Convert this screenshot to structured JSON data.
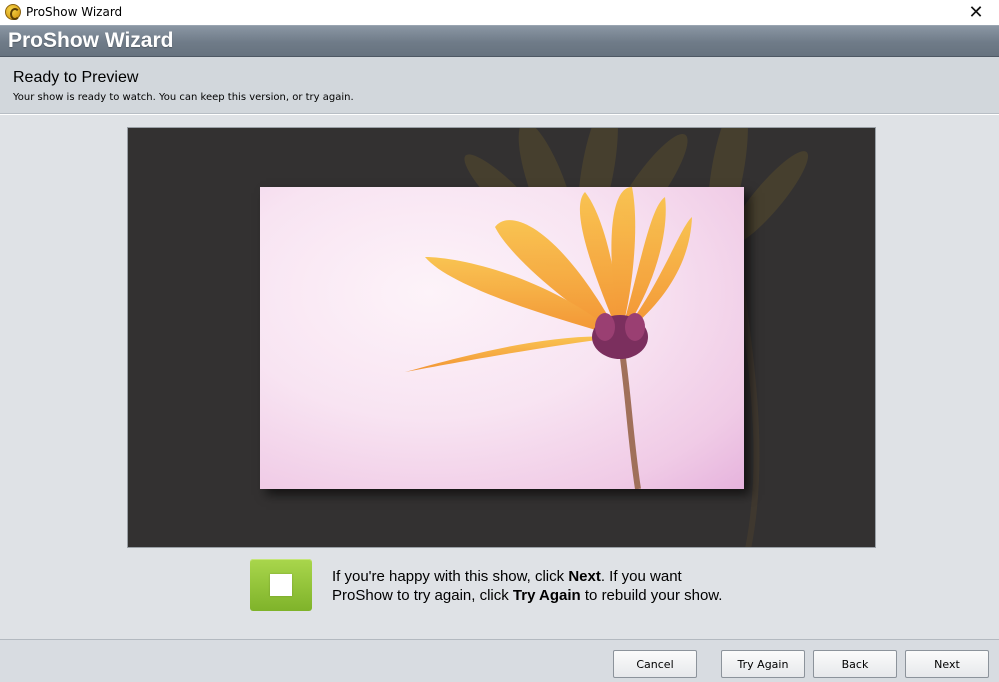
{
  "window": {
    "title": "ProShow Wizard",
    "close_glyph": "✕"
  },
  "banner": {
    "title": "ProShow Wizard"
  },
  "header": {
    "title": "Ready to Preview",
    "subtitle": "Your show is ready to watch. You can keep this version, or try again."
  },
  "message": {
    "line1_pre": "If you're happy with this show, click ",
    "line1_bold": "Next",
    "line1_post": ". If you want",
    "line2_pre": "ProShow to try again, click ",
    "line2_bold": "Try Again",
    "line2_post": " to rebuild your show."
  },
  "footer": {
    "cancel": "Cancel",
    "try_again": "Try Again",
    "back": "Back",
    "next": "Next"
  },
  "icons": {
    "app": "proshow-app-icon",
    "close": "close-icon",
    "play": "stop-square-icon"
  },
  "colors": {
    "banner": "#6f7b88",
    "header_bg": "#d2d7dc",
    "preview_bg": "#333131",
    "accent_green": "#8cc23a",
    "petal_orange": "#f6a733"
  }
}
